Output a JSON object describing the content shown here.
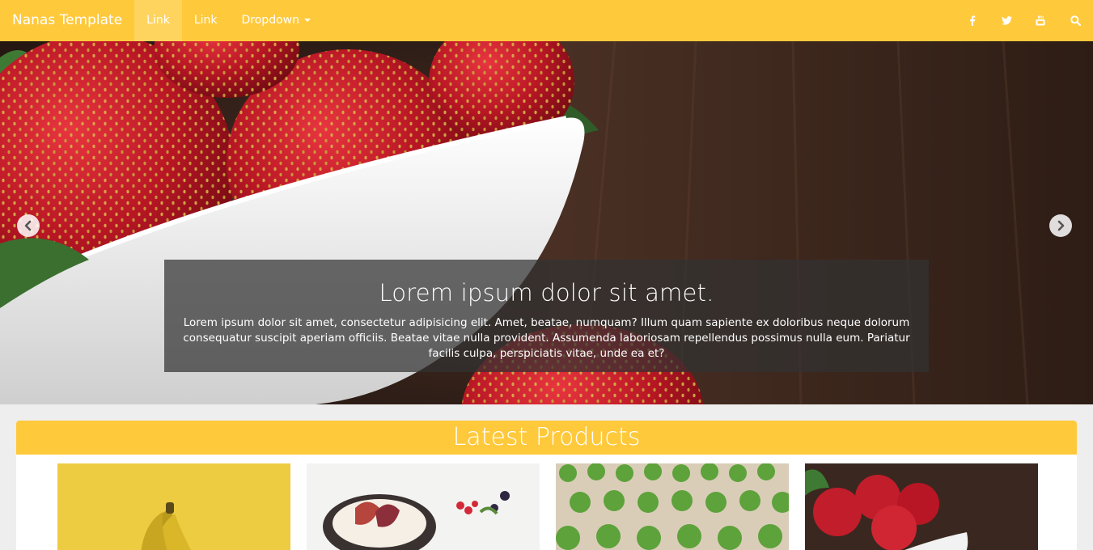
{
  "navbar": {
    "brand": "Nanas Template",
    "links": [
      {
        "label": "Link",
        "active": true
      },
      {
        "label": "Link",
        "active": false
      }
    ],
    "dropdown_label": "Dropdown",
    "social_icons": [
      "facebook-icon",
      "twitter-icon",
      "youtube-icon",
      "search-icon"
    ]
  },
  "carousel": {
    "caption_title": "Lorem ipsum dolor sit amet.",
    "caption_text": "Lorem ipsum dolor sit amet, consectetur adipisicing elit. Amet, beatae, numquam? Illum quam sapiente ex doloribus neque dolorum consequatur suscipit aperiam officiis. Beatae vitae nulla provident. Assumenda laboriosam repellendus possimus nulla eum. Pariatur facilis culpa, perspiciatis vitae, unde ea et?",
    "prev_icon": "chevron-left-icon",
    "next_icon": "chevron-right-icon"
  },
  "products": {
    "heading": "Latest Products",
    "items": [
      {
        "image": "bananas"
      },
      {
        "image": "fruit-bowl"
      },
      {
        "image": "lettuce-field"
      },
      {
        "image": "strawberries"
      }
    ]
  },
  "colors": {
    "accent": "#ffc93c",
    "background": "#eeeeee"
  }
}
